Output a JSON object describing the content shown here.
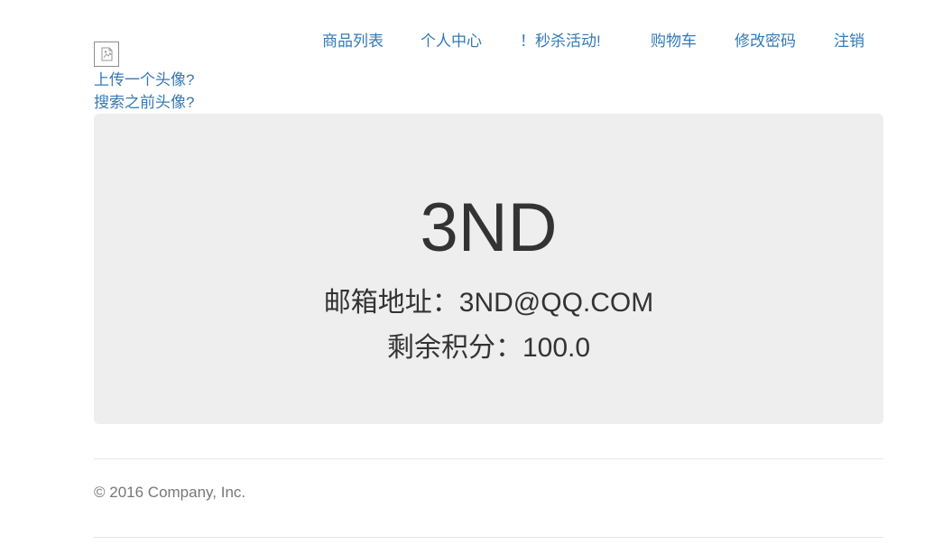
{
  "nav": {
    "items": [
      {
        "label": "商品列表"
      },
      {
        "label": "个人中心"
      },
      {
        "label": "！秒杀活动!"
      },
      {
        "label": "购物车"
      },
      {
        "label": "修改密码"
      },
      {
        "label": "注销"
      }
    ]
  },
  "avatar": {
    "icon": "broken-image-icon",
    "upload_label": "上传一个头像?",
    "search_label": "搜索之前头像?"
  },
  "profile": {
    "username": "3ND",
    "email_line": "邮箱地址：3ND@QQ.COM",
    "points_line": "剩余积分：100.0"
  },
  "footer": {
    "copyright": "© 2016 Company, Inc."
  },
  "colors": {
    "link": "#337ab7",
    "jumbotron_bg": "#eeeeee",
    "text": "#333333",
    "muted": "#777777"
  }
}
